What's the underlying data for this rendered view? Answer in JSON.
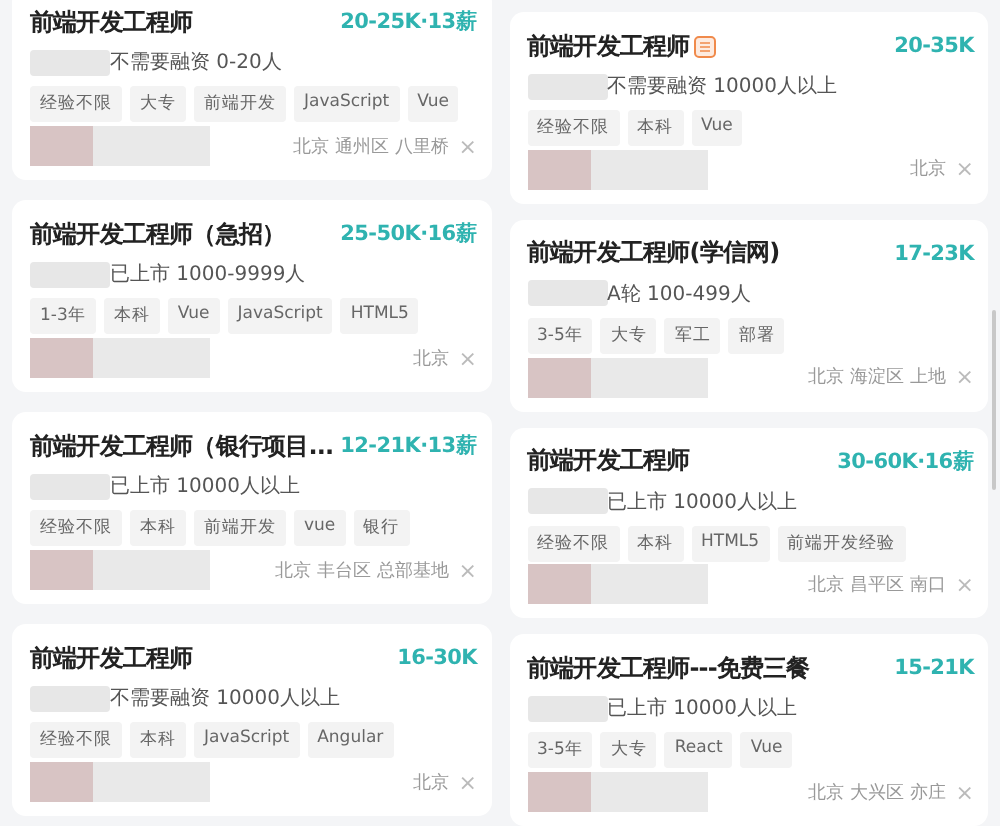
{
  "columns": [
    {
      "jobs": [
        {
          "title": "前端开发工程师",
          "badge": false,
          "salary": "20-25K·13薪",
          "company_info": "不需要融资 0-20人",
          "tags": [
            "经验不限",
            "大专",
            "前端开发",
            "JavaScript",
            "Vue"
          ],
          "location": "北京 通州区 八里桥",
          "dismiss": "×"
        },
        {
          "title": "前端开发工程师（急招）",
          "badge": false,
          "salary": "25-50K·16薪",
          "company_info": "已上市 1000-9999人",
          "tags": [
            "1-3年",
            "本科",
            "Vue",
            "JavaScript",
            "HTML5"
          ],
          "location": "北京",
          "dismiss": "×"
        },
        {
          "title": "前端开发工程师（银行项目...",
          "badge": false,
          "salary": "12-21K·13薪",
          "company_info": "已上市 10000人以上",
          "tags": [
            "经验不限",
            "本科",
            "前端开发",
            "vue",
            "银行"
          ],
          "location": "北京 丰台区 总部基地",
          "dismiss": "×"
        },
        {
          "title": "前端开发工程师",
          "badge": false,
          "salary": "16-30K",
          "company_info": "不需要融资 10000人以上",
          "tags": [
            "经验不限",
            "本科",
            "JavaScript",
            "Angular"
          ],
          "location": "北京",
          "dismiss": "×"
        }
      ]
    },
    {
      "jobs": [
        {
          "title": "前端开发工程师",
          "badge": true,
          "salary": "20-35K",
          "company_info": "不需要融资 10000人以上",
          "tags": [
            "经验不限",
            "本科",
            "Vue"
          ],
          "location": "北京",
          "dismiss": "×"
        },
        {
          "title": "前端开发工程师(学信网)",
          "badge": false,
          "salary": "17-23K",
          "company_info": "A轮 100-499人",
          "tags": [
            "3-5年",
            "大专",
            "军工",
            "部署"
          ],
          "location": "北京 海淀区 上地",
          "dismiss": "×"
        },
        {
          "title": "前端开发工程师",
          "badge": false,
          "salary": "30-60K·16薪",
          "company_info": "已上市 10000人以上",
          "tags": [
            "经验不限",
            "本科",
            "HTML5",
            "前端开发经验"
          ],
          "location": "北京 昌平区 南口",
          "dismiss": "×"
        },
        {
          "title": "前端开发工程师---免费三餐",
          "badge": false,
          "salary": "15-21K",
          "company_info": "已上市 10000人以上",
          "tags": [
            "3-5年",
            "大专",
            "React",
            "Vue"
          ],
          "location": "北京 大兴区 亦庄",
          "dismiss": "×"
        }
      ]
    }
  ]
}
